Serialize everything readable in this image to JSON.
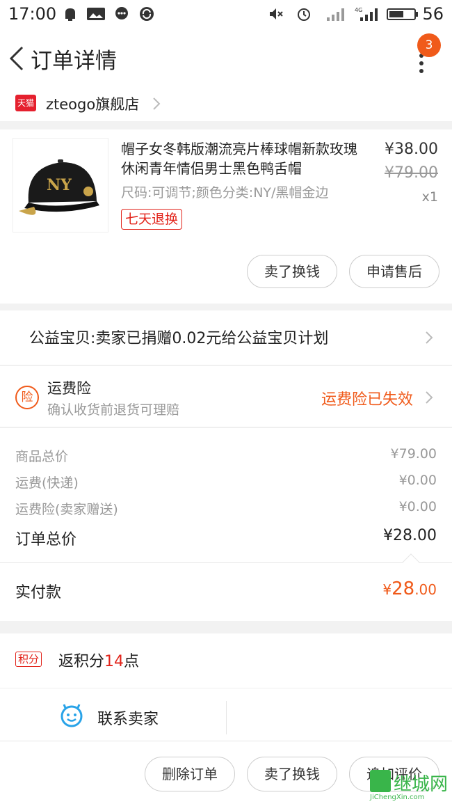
{
  "status_bar": {
    "time": "17:00",
    "battery": "56"
  },
  "header": {
    "title": "订单详情",
    "badge": "3"
  },
  "store": {
    "badge": "天猫",
    "name": "zteogo旗舰店"
  },
  "product": {
    "title": "帽子女冬韩版潮流亮片棒球帽新款玫瑰休闲青年情侣男士黑色鸭舌帽",
    "sku": "尺码:可调节;颜色分类:NY/黑帽金边",
    "tag": "七天退换",
    "price": "¥38.00",
    "original_price": "¥79.00",
    "qty": "x1",
    "buttons": [
      "卖了换钱",
      "申请售后"
    ]
  },
  "charity": {
    "text": "公益宝贝:卖家已捐赠0.02元给公益宝贝计划"
  },
  "insurance": {
    "icon_label": "险",
    "title": "运费险",
    "subtitle": "确认收货前退货可理赔",
    "status": "运费险已失效"
  },
  "summary": {
    "rows": [
      {
        "label": "商品总价",
        "value": "¥79.00"
      },
      {
        "label": "运费(快递)",
        "value": "¥0.00"
      },
      {
        "label": "运费险(卖家赠送)",
        "value": "¥0.00"
      }
    ],
    "total_label": "订单总价",
    "total_value": "¥28.00"
  },
  "paid": {
    "label": "实付款",
    "currency": "¥",
    "integer": "28",
    "decimal": ".00"
  },
  "points": {
    "tag": "积分",
    "prefix": "返积分",
    "num": "14",
    "suffix": "点"
  },
  "contact": {
    "label": "联系卖家"
  },
  "actions": [
    "删除订单",
    "卖了换钱",
    "追加评价"
  ],
  "watermark": {
    "text": "继城网",
    "sub": "JiChengXin.com"
  },
  "colors": {
    "accent": "#f05a1a",
    "red": "#e2231a"
  }
}
